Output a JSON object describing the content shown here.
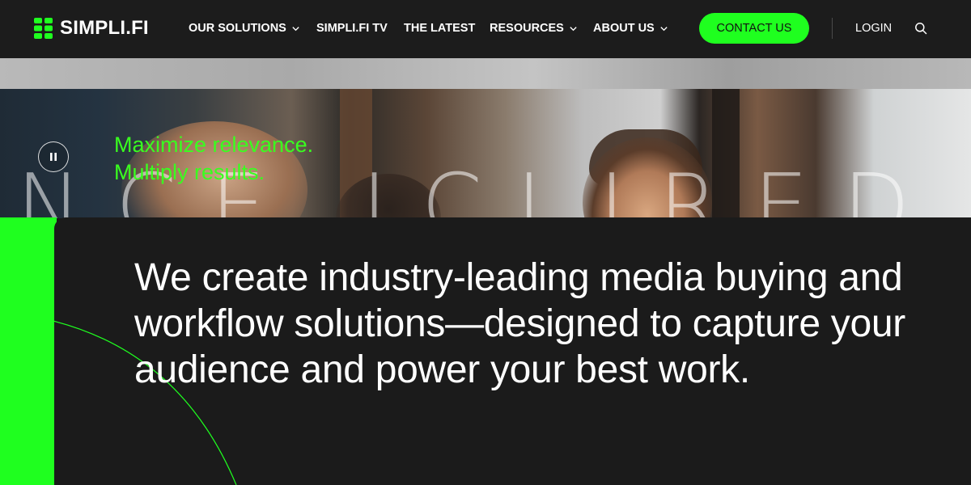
{
  "header": {
    "logo_text": "SIMPLI.FI",
    "nav": [
      {
        "label": "OUR SOLUTIONS",
        "has_dropdown": true
      },
      {
        "label": "SIMPLI.FI TV",
        "has_dropdown": false
      },
      {
        "label": "THE LATEST",
        "has_dropdown": false
      },
      {
        "label": "RESOURCES",
        "has_dropdown": true
      },
      {
        "label": "ABOUT US",
        "has_dropdown": true
      }
    ],
    "contact_label": "CONTACT US",
    "login_label": "LOGIN",
    "icons": {
      "logo": "simplifi-logo-icon",
      "dropdown": "chevron-down-icon",
      "search": "search-icon"
    }
  },
  "hero": {
    "tagline_line1": "Maximize relevance.",
    "tagline_line2": "Multiply results.",
    "background_letters": "NCE ICLIRED",
    "pause_icon": "pause-icon"
  },
  "intro": {
    "headline": "We create industry-leading media buying and workflow solutions—designed to capture your audience and power your best work."
  },
  "colors": {
    "brand_green": "#1fff1f",
    "tagline_green": "#39ff1f",
    "header_bg": "#1c1c1c",
    "panel_bg": "#1b1b1b",
    "text": "#ffffff"
  }
}
